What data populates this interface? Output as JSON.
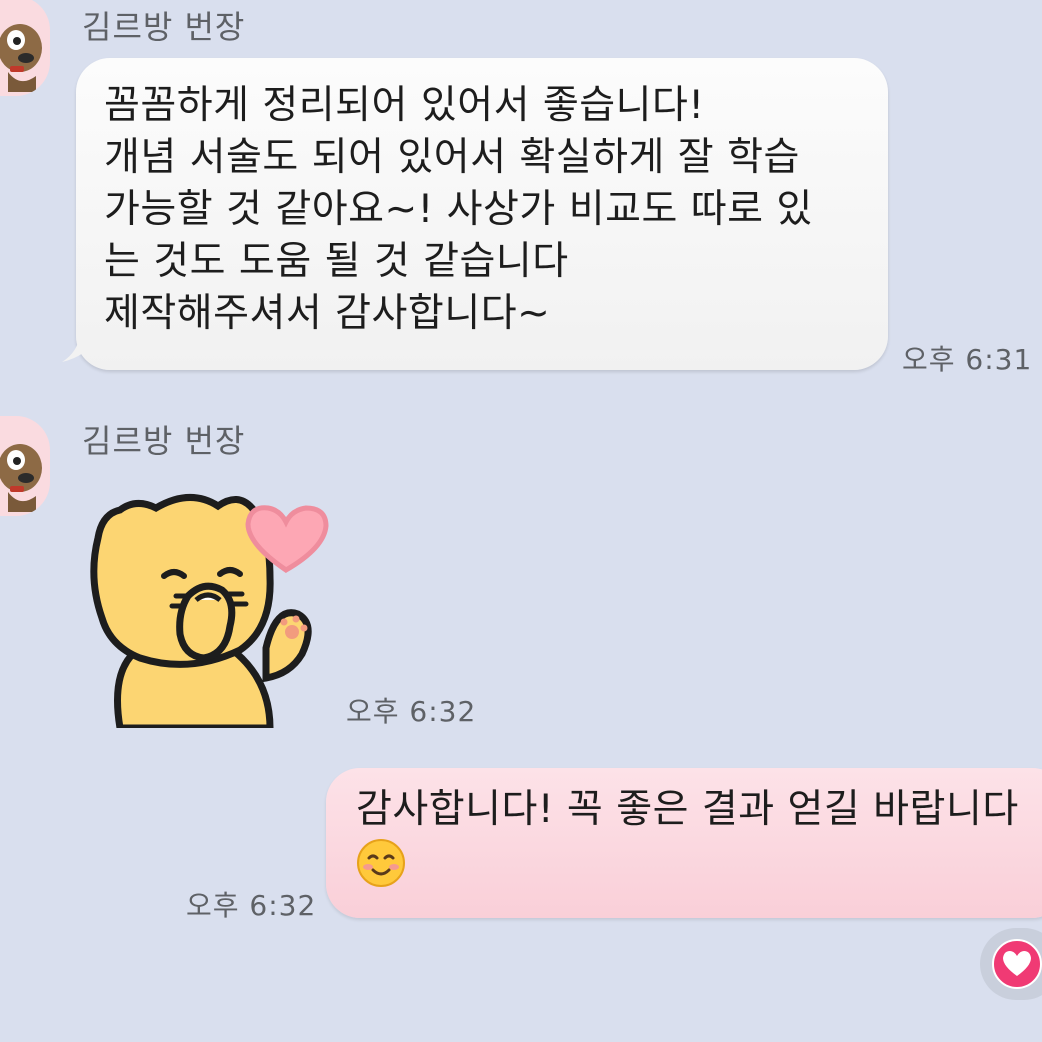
{
  "messages": [
    {
      "sender": "김르방 번장",
      "lines": [
        "꼼꼼하게 정리되어 있어서 좋습니다!",
        "개념 서술도 되어 있어서 확실하게 잘 학습",
        "가능할 것 같아요~! 사상가 비교도 따로 있",
        "는 것도 도움 될 것 같습니다",
        "제작해주셔서 감사합니다~"
      ],
      "time": "오후 6:31"
    },
    {
      "sender": "김르방 번장",
      "sticker": "cat-heart-sticker",
      "time": "오후 6:32"
    },
    {
      "outgoing": true,
      "lines": [
        "감사합니다! 꼭 좋은 결과 얻길 바랍니다"
      ],
      "emoji": "smiling-face-icon",
      "time": "오후 6:32"
    }
  ],
  "reaction": {
    "icon": "heart-icon"
  },
  "colors": {
    "background": "#d9dfee",
    "incoming_bubble": "#f4f4f4",
    "outgoing_bubble": "#fbd5dd",
    "avatar_bg": "#fadbe0",
    "reaction_heart": "#f03a74"
  }
}
